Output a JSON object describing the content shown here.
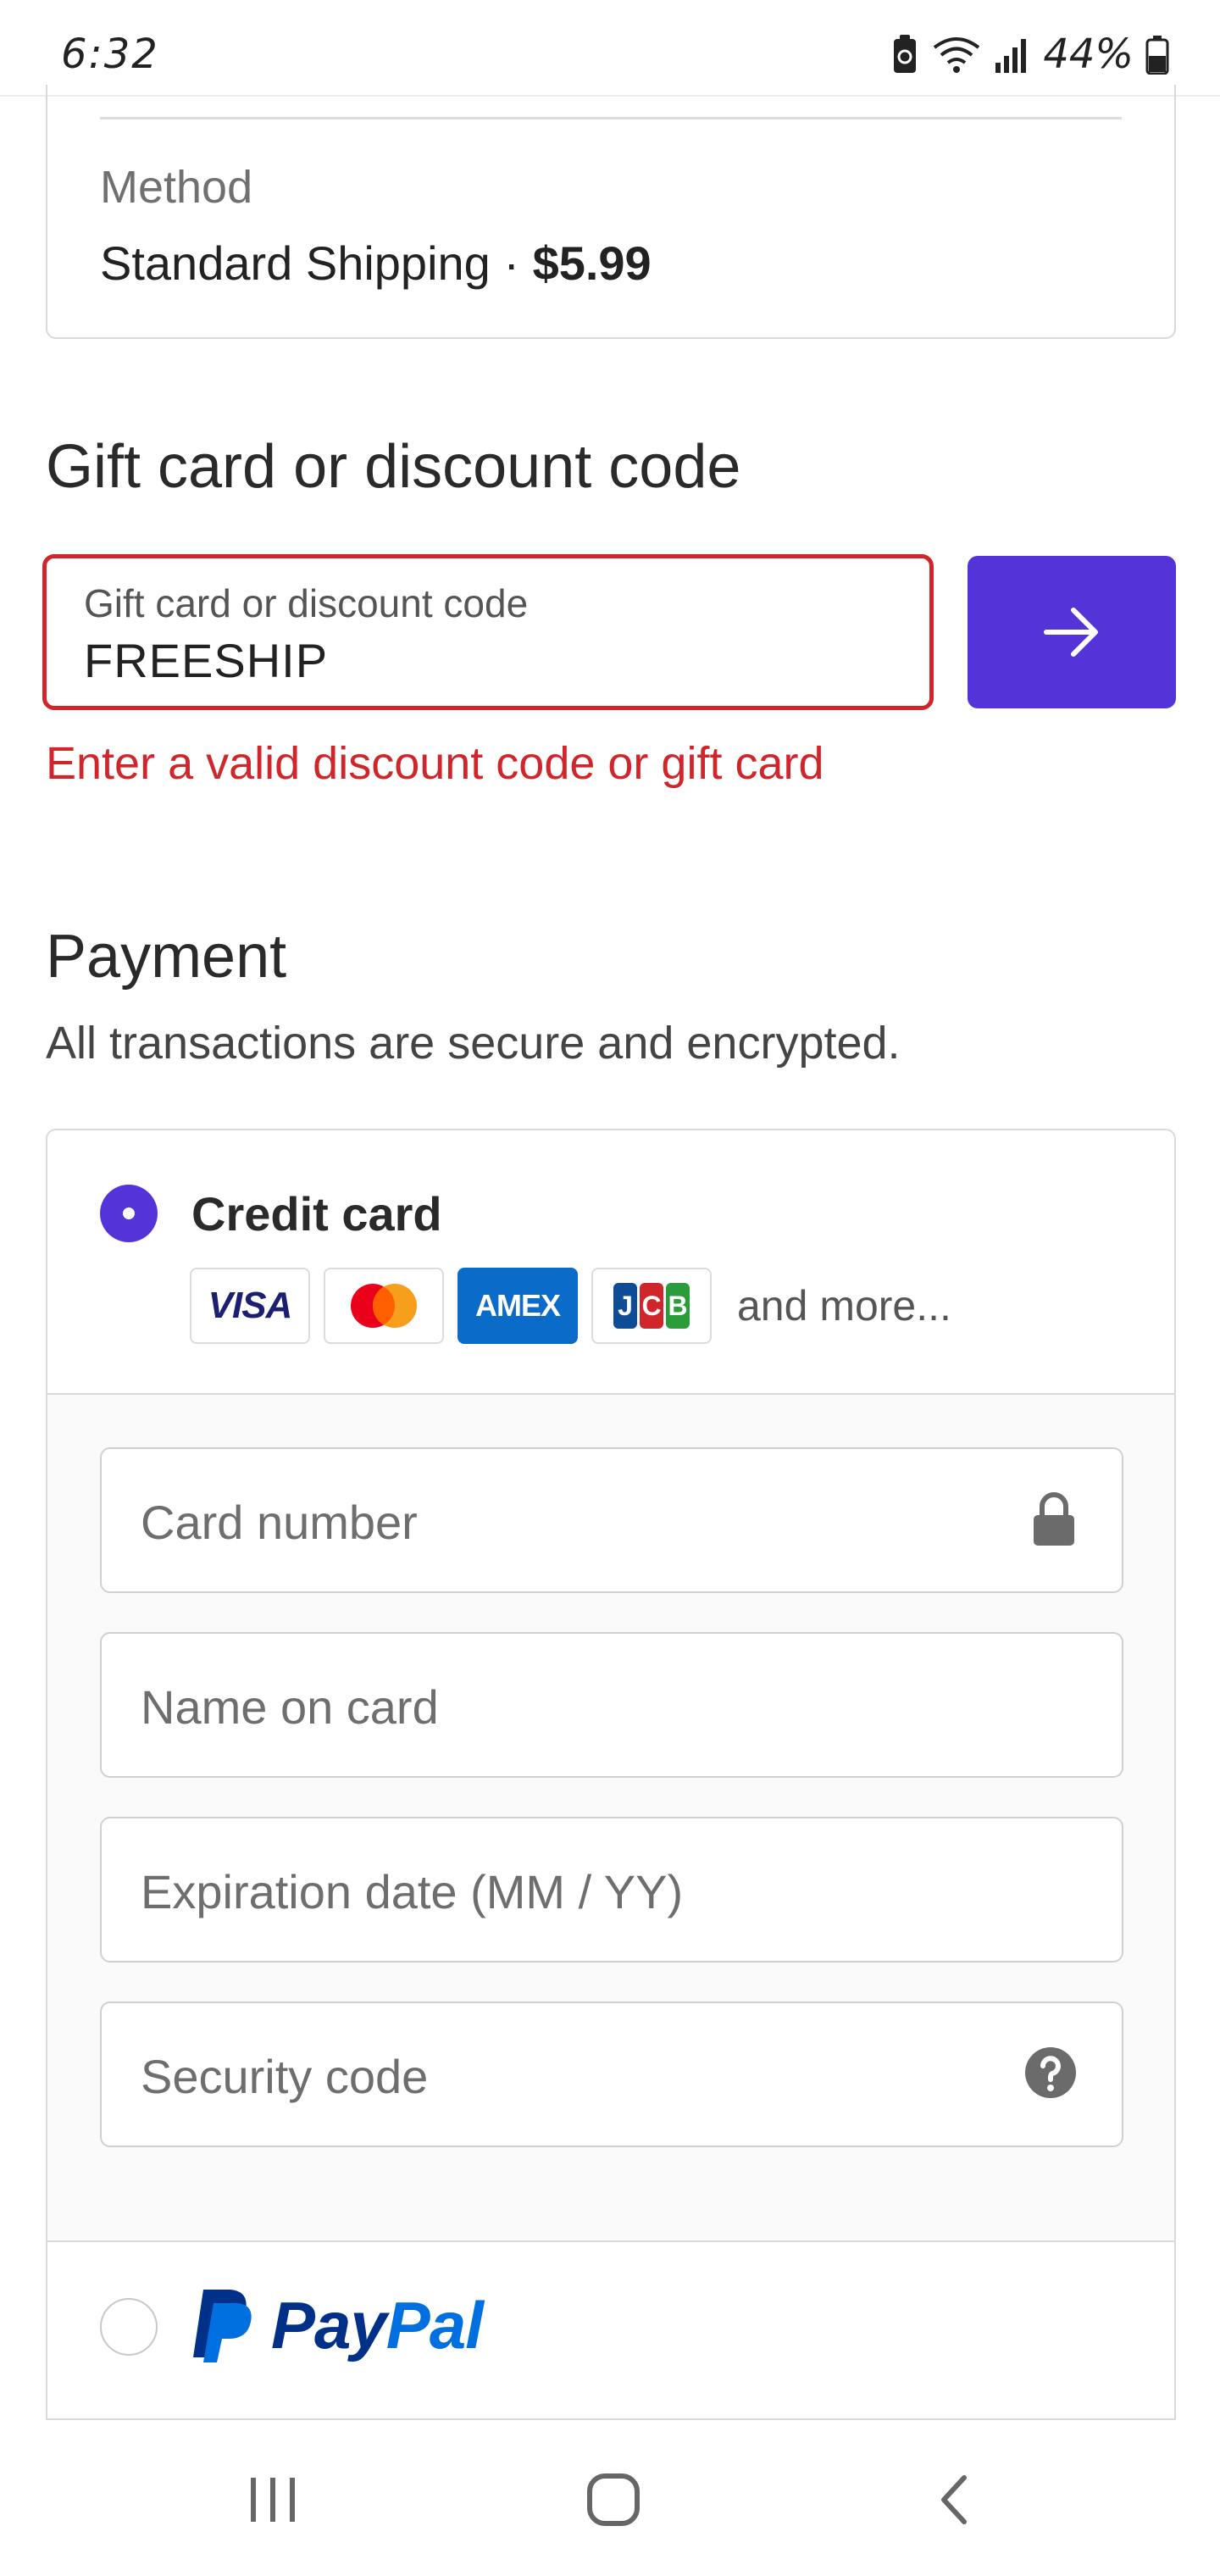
{
  "status_bar": {
    "time": "6:32",
    "battery": "44%"
  },
  "shipping": {
    "method_label": "Method",
    "method_name": "Standard Shipping · ",
    "method_price": "$5.99"
  },
  "gift": {
    "heading": "Gift card or discount code",
    "input_label": "Gift card or discount code",
    "input_value": "FREESHIP",
    "error": "Enter a valid discount code or gift card",
    "error_color": "#d0262b"
  },
  "payment": {
    "heading": "Payment",
    "subtitle": "All transactions are secure and encrypted.",
    "credit_card_label": "Credit card",
    "card_brands": [
      "VISA",
      "Mastercard",
      "AMEX",
      "JCB"
    ],
    "visa_text": "VISA",
    "amex_text": "AMEX",
    "jcb_letters": [
      "J",
      "C",
      "B"
    ],
    "more_text": "and more...",
    "fields": {
      "card_number": "Card number",
      "name_on_card": "Name on card",
      "expiration": "Expiration date (MM / YY)",
      "security_code": "Security code"
    },
    "paypal_pay": "Pay",
    "paypal_pal": "Pal",
    "accent_color": "#5433d9"
  },
  "icons": {
    "submit": "arrow-right-icon",
    "card_number": "lock-icon",
    "security_code": "question-circle-icon",
    "nav_recents": "recents-icon",
    "nav_home": "home-icon",
    "nav_back": "back-icon"
  }
}
